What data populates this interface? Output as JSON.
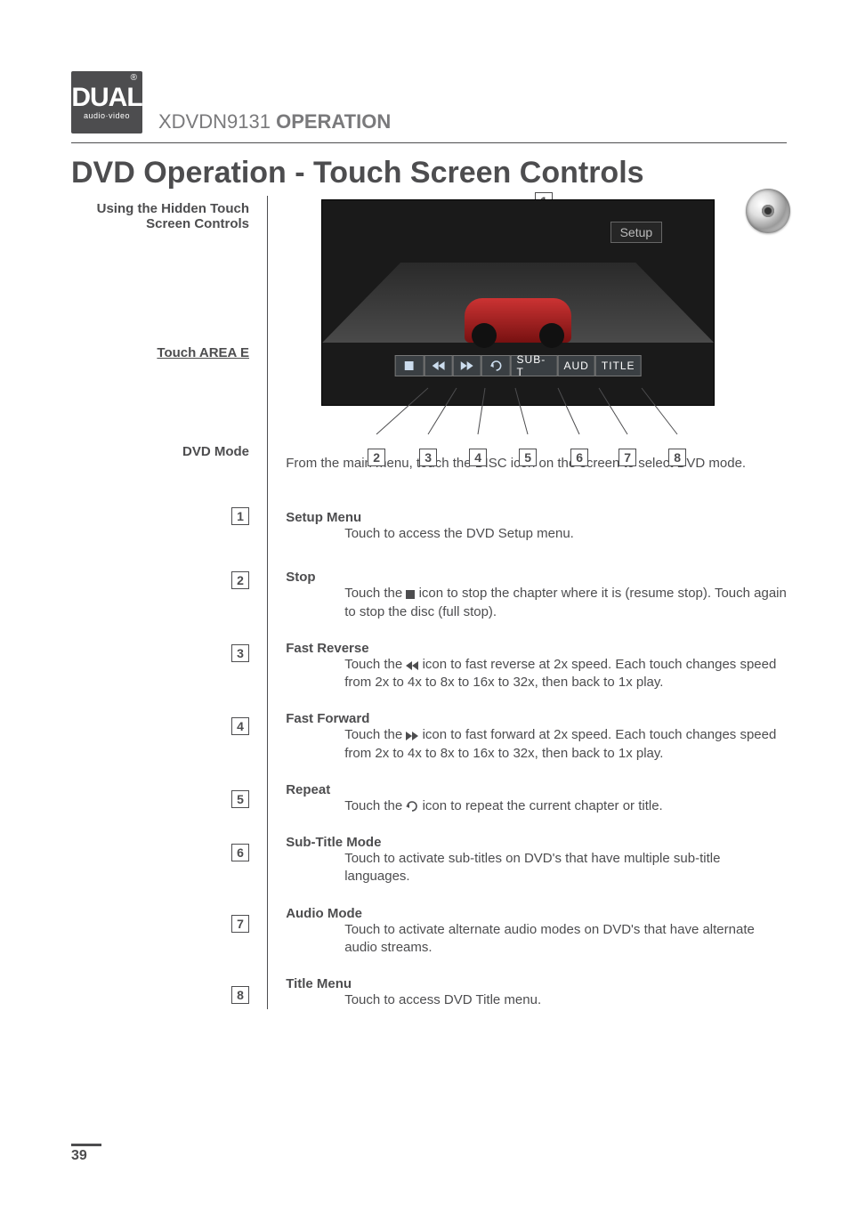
{
  "header": {
    "logo_main": "DUAL",
    "logo_sub": "audio·video",
    "logo_reg": "®",
    "model": "XDVDN9131",
    "section": "OPERATION"
  },
  "title": "DVD Operation - Touch Screen Controls",
  "left": {
    "using_hidden_1": "Using the Hidden Touch",
    "using_hidden_2": "Screen Controls",
    "touch_area": "Touch AREA E",
    "dvd_mode": "DVD Mode"
  },
  "screen": {
    "setup": "Setup",
    "controls": {
      "stop": "■",
      "rev": "◄◄",
      "fwd": "►►",
      "repeat": "↻",
      "subt": "SUB-T",
      "aud": "AUD",
      "title": "TITLE"
    }
  },
  "callouts": {
    "c1": "1",
    "c2": "2",
    "c3": "3",
    "c4": "4",
    "c5": "5",
    "c6": "6",
    "c7": "7",
    "c8": "8"
  },
  "dvd_mode_text": "From the main menu, touch the DISC icon on the screen to select DVD mode.",
  "items": [
    {
      "num": "1",
      "title": "Setup Menu",
      "body": "Touch to access the DVD Setup menu.",
      "icon": null
    },
    {
      "num": "2",
      "title": "Stop",
      "body_pre": "Touch the ",
      "body_post": " icon to stop the chapter where it is (resume stop). Touch again to stop the disc (full stop).",
      "icon": "stop"
    },
    {
      "num": "3",
      "title": "Fast Reverse",
      "body_pre": "Touch the ",
      "body_post": " icon to fast reverse at 2x speed. Each touch changes speed from 2x to 4x to 8x to 16x to 32x, then back to 1x play.",
      "icon": "rev"
    },
    {
      "num": "4",
      "title": "Fast Forward",
      "body_pre": "Touch the ",
      "body_post": " icon to fast forward at 2x speed. Each touch changes speed from 2x to 4x to 8x to 16x to 32x, then back to 1x play.",
      "icon": "fwd"
    },
    {
      "num": "5",
      "title": "Repeat",
      "body_pre": "Touch the ",
      "body_post": " icon to repeat the current chapter or title.",
      "icon": "repeat"
    },
    {
      "num": "6",
      "title": "Sub-Title Mode",
      "body": "Touch to activate sub-titles on DVD's that have multiple sub-title languages.",
      "icon": null
    },
    {
      "num": "7",
      "title": "Audio Mode",
      "body": "Touch to activate alternate audio modes on DVD's that have alternate audio streams.",
      "icon": null
    },
    {
      "num": "8",
      "title": "Title Menu",
      "body": "Touch to access DVD Title menu.",
      "icon": null
    }
  ],
  "page_number": "39"
}
